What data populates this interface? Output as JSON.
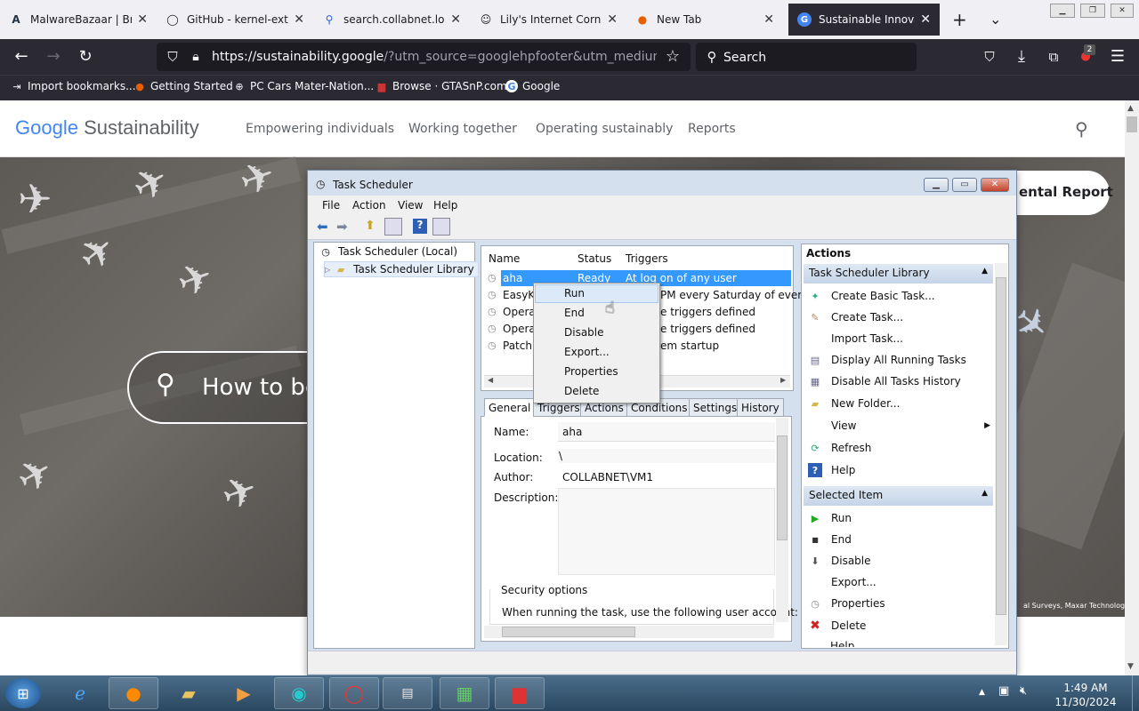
{
  "browser": {
    "tabs": [
      {
        "title": "MalwareBazaar | Brow",
        "icon": "A"
      },
      {
        "title": "GitHub - kernel-extens",
        "icon": "◯"
      },
      {
        "title": "search.collabnet.local/",
        "icon": "⚲"
      },
      {
        "title": "Lily's Internet Corner",
        "icon": "☺"
      },
      {
        "title": "New Tab",
        "icon": "●"
      },
      {
        "title": "Sustainable Innovatio",
        "icon": "G"
      }
    ],
    "url_host": "https://sustainability.google",
    "url_rest": "/?utm_source=googlehpfooter&utm_medium=housep",
    "search_placeholder": "Search",
    "extension_badge": "2",
    "bookmarks": [
      {
        "label": "Import bookmarks...",
        "icon": "⇥"
      },
      {
        "label": "Getting Started",
        "icon": "●"
      },
      {
        "label": "PC Cars Mater-Nation...",
        "icon": "⊕"
      },
      {
        "label": "Browse · GTASnP.com",
        "icon": "▆"
      },
      {
        "label": "Google",
        "icon": "G"
      }
    ]
  },
  "site": {
    "logo_google": "Google",
    "logo_product": "Sustainability",
    "nav": [
      "Empowering individuals",
      "Working together",
      "Operating sustainably",
      "Reports"
    ],
    "search_text": "How to be",
    "report_pill": "ental Report",
    "map_credit": "al Surveys, Maxar Technologies"
  },
  "task_scheduler": {
    "title": "Task Scheduler",
    "menu": [
      "File",
      "Action",
      "View",
      "Help"
    ],
    "tree": {
      "root": "Task Scheduler (Local)",
      "child": "Task Scheduler Library"
    },
    "columns": {
      "name": "Name",
      "status": "Status",
      "triggers": "Triggers"
    },
    "tasks": [
      {
        "name": "aha",
        "status": "Ready",
        "trigger": "At log on of any user"
      },
      {
        "name": "EasyKM",
        "status": "",
        "trigger": "PM every Saturday of every w"
      },
      {
        "name": "Opera",
        "status": "",
        "trigger": "e triggers defined"
      },
      {
        "name": "Opera",
        "status": "",
        "trigger": "e triggers defined"
      },
      {
        "name": "Patch",
        "status": "",
        "trigger": "em startup"
      }
    ],
    "context_menu": [
      "Run",
      "End",
      "Disable",
      "Export...",
      "Properties",
      "Delete"
    ],
    "detail_tabs": [
      "General",
      "Triggers",
      "Actions",
      "Conditions",
      "Settings",
      "History"
    ],
    "general": {
      "name_label": "Name:",
      "name_value": "aha",
      "location_label": "Location:",
      "location_value": "\\",
      "author_label": "Author:",
      "author_value": "COLLABNET\\VM1",
      "description_label": "Description:",
      "security_label": "Security options",
      "security_text": "When running the task, use the following user account:"
    },
    "actions_title": "Actions",
    "library_section": "Task Scheduler Library",
    "library_actions": [
      {
        "label": "Create Basic Task...",
        "icon": "✦"
      },
      {
        "label": "Create Task...",
        "icon": "✎"
      },
      {
        "label": "Import Task...",
        "icon": ""
      },
      {
        "label": "Display All Running Tasks",
        "icon": "▤"
      },
      {
        "label": "Disable All Tasks History",
        "icon": "▦"
      },
      {
        "label": "New Folder...",
        "icon": "▰"
      },
      {
        "label": "View",
        "icon": ""
      },
      {
        "label": "Refresh",
        "icon": "⟳"
      },
      {
        "label": "Help",
        "icon": "?"
      }
    ],
    "selected_section": "Selected Item",
    "selected_actions": [
      {
        "label": "Run",
        "icon": "▶"
      },
      {
        "label": "End",
        "icon": "■"
      },
      {
        "label": "Disable",
        "icon": "⬇"
      },
      {
        "label": "Export...",
        "icon": ""
      },
      {
        "label": "Properties",
        "icon": "◷"
      },
      {
        "label": "Delete",
        "icon": "✖"
      },
      {
        "label": "Help",
        "icon": ""
      }
    ]
  },
  "taskbar": {
    "time": "1:49 AM",
    "date": "11/30/2024"
  },
  "colors": {
    "ts_selection": "#3399ff",
    "ctx_highlight": "#dce9f9",
    "delete_red": "#d02020"
  }
}
